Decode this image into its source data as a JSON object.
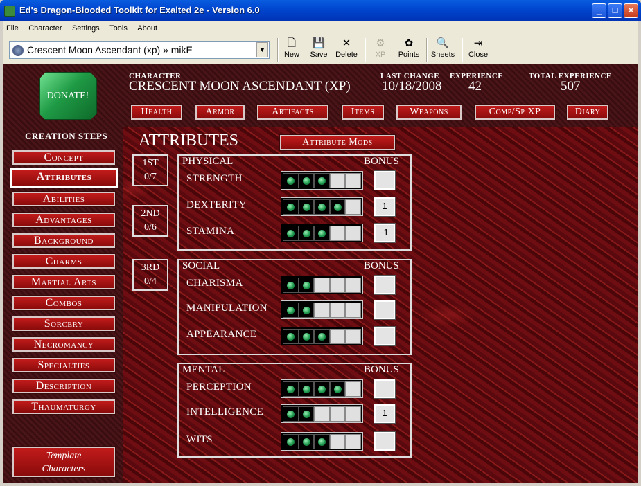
{
  "window": {
    "title": "Ed's Dragon-Blooded Toolkit for Exalted 2e - Version 6.0",
    "min": "_",
    "max": "□",
    "close": "×"
  },
  "menu": [
    "File",
    "Character",
    "Settings",
    "Tools",
    "About"
  ],
  "toolbar": {
    "character_select": "Crescent Moon Ascendant (xp) » mikE",
    "buttons": [
      {
        "label": "New",
        "glyph": "🗋"
      },
      {
        "label": "Save",
        "glyph": "💾"
      },
      {
        "label": "Delete",
        "glyph": "✕"
      },
      {
        "label": "XP",
        "glyph": "⚙"
      },
      {
        "label": "Points",
        "glyph": "✿"
      },
      {
        "label": "Sheets",
        "glyph": "🔍"
      },
      {
        "label": "Close",
        "glyph": "⇥"
      }
    ]
  },
  "header": {
    "donate": "DONATE!",
    "character_label": "CHARACTER",
    "character_name": "CRESCENT MOON ASCENDANT (XP)",
    "last_change_label": "LAST CHANGE",
    "last_change": "10/18/2008",
    "experience_label": "EXPERIENCE",
    "experience": "42",
    "total_experience_label": "TOTAL EXPERIENCE",
    "total_experience": "507",
    "tabs": [
      "Health",
      "Armor",
      "Artifacts",
      "Items",
      "Weapons",
      "Comp/Sp XP",
      "Diary"
    ]
  },
  "sidebar": {
    "title": "CREATION STEPS",
    "steps": [
      "Concept",
      "Attributes",
      "Abilities",
      "Advantages",
      "Background",
      "Charms",
      "Martial Arts",
      "Combos",
      "Sorcery",
      "Necromancy",
      "Specialties",
      "Description",
      "Thaumaturgy"
    ],
    "active": "Attributes",
    "template_line1": "Template",
    "template_line2": "Characters"
  },
  "content": {
    "title": "ATTRIBUTES",
    "mods_button": "Attribute Mods",
    "priorities": [
      {
        "rank": "1ST",
        "value": "0/7"
      },
      {
        "rank": "2ND",
        "value": "0/6"
      },
      {
        "rank": "3RD",
        "value": "0/4"
      }
    ],
    "bonus_label": "BONUS",
    "groups": [
      {
        "name": "PHYSICAL",
        "attributes": [
          {
            "name": "STRENGTH",
            "dots": 3,
            "bonus": ""
          },
          {
            "name": "DEXTERITY",
            "dots": 4,
            "bonus": "1"
          },
          {
            "name": "STAMINA",
            "dots": 3,
            "bonus": "-1"
          }
        ]
      },
      {
        "name": "SOCIAL",
        "attributes": [
          {
            "name": "CHARISMA",
            "dots": 2,
            "bonus": ""
          },
          {
            "name": "MANIPULATION",
            "dots": 2,
            "bonus": ""
          },
          {
            "name": "APPEARANCE",
            "dots": 3,
            "bonus": ""
          }
        ]
      },
      {
        "name": "MENTAL",
        "attributes": [
          {
            "name": "PERCEPTION",
            "dots": 4,
            "bonus": ""
          },
          {
            "name": "INTELLIGENCE",
            "dots": 2,
            "bonus": "1"
          },
          {
            "name": "WITS",
            "dots": 3,
            "bonus": ""
          }
        ]
      }
    ],
    "max_dots": 5
  }
}
